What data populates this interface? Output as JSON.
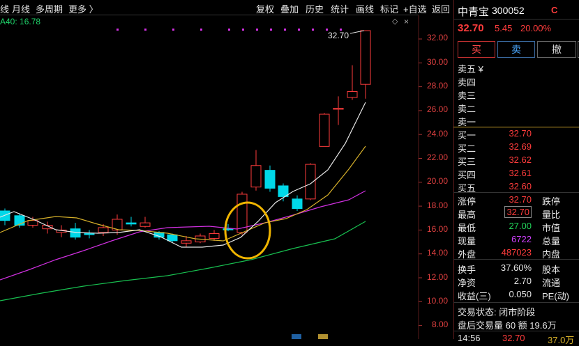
{
  "toolbar": {
    "left": [
      "线",
      "月线",
      "多周期",
      "更多 〉"
    ],
    "right": [
      "复权",
      "叠加",
      "历史",
      "统计",
      "画线",
      "标记",
      "+自选",
      "返回"
    ]
  },
  "ma_label": "A40: 16.78",
  "price_axis": [
    "32.00",
    "30.00",
    "28.00",
    "26.00",
    "24.00",
    "22.00",
    "20.00",
    "18.00",
    "16.00",
    "14.00",
    "12.00",
    "10.00",
    "8.00"
  ],
  "high_marker": "32.70",
  "stock": {
    "name": "中青宝",
    "code": "300052",
    "badge": "C",
    "price": "32.70",
    "change": "5.45",
    "pct": "20.00%"
  },
  "buttons": {
    "buy": "买",
    "sell": "卖",
    "cancel": "撤"
  },
  "ask": [
    "卖五 ¥",
    "卖四",
    "卖三",
    "卖二",
    "卖一"
  ],
  "bid": [
    {
      "label": "买一",
      "value": "32.70"
    },
    {
      "label": "买二",
      "value": "32.69"
    },
    {
      "label": "买三",
      "value": "32.62"
    },
    {
      "label": "买四",
      "value": "32.61"
    },
    {
      "label": "买五",
      "value": "32.60"
    }
  ],
  "stats": [
    {
      "label": "涨停",
      "value": "32.70",
      "label2": "跌停"
    },
    {
      "label": "最高",
      "value": "32.70",
      "label2": "量比"
    },
    {
      "label": "最低",
      "value": "27.00",
      "label2": "市值"
    },
    {
      "label": "现量",
      "value": "6722",
      "label2": "总量"
    },
    {
      "label": "外盘",
      "value": "487023",
      "label2": "内盘"
    },
    {
      "label": "换手",
      "value": "37.60%",
      "label2": "股本"
    },
    {
      "label": "净资",
      "value": "2.70",
      "label2": "流通"
    },
    {
      "label": "收益(三)",
      "value": "0.050",
      "label2": "PE(动)"
    }
  ],
  "status": {
    "trade": "交易状态: 闭市阶段",
    "after": "盘后交易量 60 额 19.6万"
  },
  "bottom": {
    "time": "14:56",
    "price": "32.70",
    "vol": "37.0万"
  },
  "colors": {
    "up": "#ff3c3c",
    "down": "#00d8e8",
    "ma5": "#ffffff",
    "ma10": "#d6b02a",
    "ma20": "#d030e0",
    "ma40": "#18c050"
  }
}
